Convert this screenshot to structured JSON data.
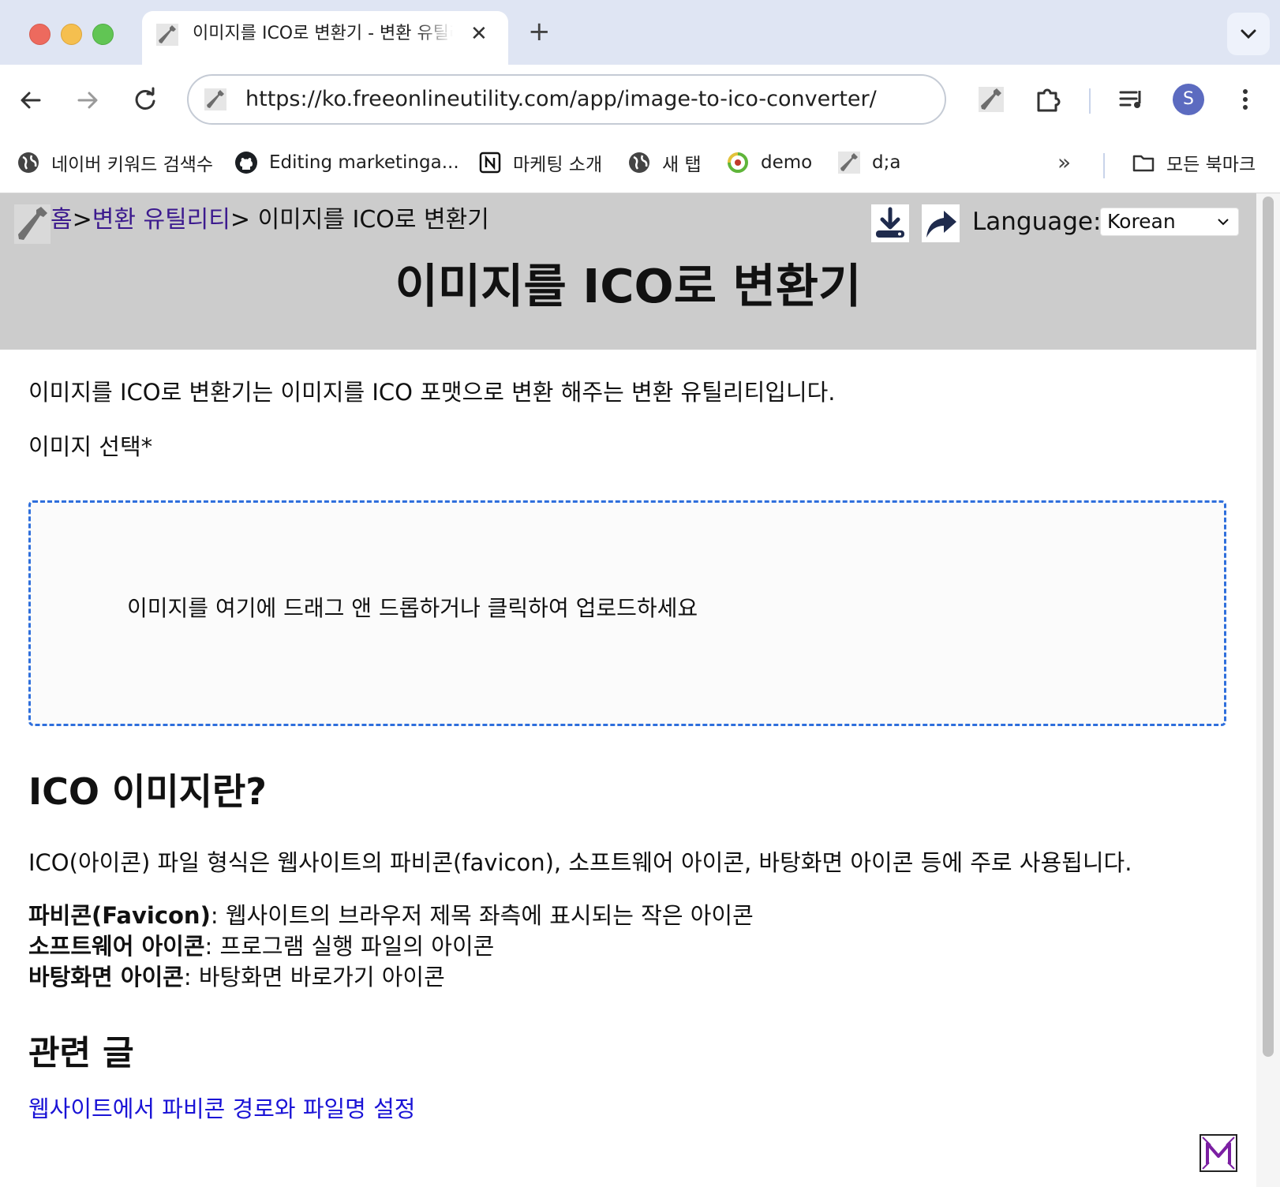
{
  "browser": {
    "tab": {
      "title": "이미지를 ICO로 변환기 - 변환 유틸리티"
    },
    "address_bar": {
      "url": "https://ko.freeonlineutility.com/app/image-to-ico-converter/"
    },
    "profile_initial": "S",
    "bookmarks": [
      {
        "label": "네이버 키워드 검색수",
        "icon": "globe-icon"
      },
      {
        "label": "Editing marketinga...",
        "icon": "github-icon"
      },
      {
        "label": "마케팅 소개",
        "icon": "notion-icon"
      },
      {
        "label": "새 탭",
        "icon": "globe-icon"
      },
      {
        "label": "demo",
        "icon": "recycle-icon"
      },
      {
        "label": "d;a",
        "icon": "wrench-icon"
      }
    ],
    "all_bookmarks_label": "모든 북마크"
  },
  "page": {
    "breadcrumb": {
      "home": "홈",
      "sep1": ">",
      "category": "변환 유틸리티",
      "current": "> 이미지를 ICO로 변환기"
    },
    "language_label": "Language:",
    "language_value": "Korean",
    "title": "이미지를 ICO로 변환기",
    "intro": "이미지를 ICO로 변환기는 이미지를 ICO 포맷으로 변환 해주는 변환 유틸리티입니다.",
    "select_label": "이미지 선택*",
    "dropzone_text": "이미지를 여기에 드래그 앤 드롭하거나 클릭하여 업로드하세요",
    "what_heading": "ICO 이미지란?",
    "description": "ICO(아이콘) 파일 형식은 웹사이트의 파비콘(favicon), 소프트웨어 아이콘, 바탕화면 아이콘 등에 주로 사용됩니다.",
    "uses": [
      {
        "term": "파비콘(Favicon)",
        "text": ": 웹사이트의 브라우저 제목 좌측에 표시되는 작은 아이콘"
      },
      {
        "term": "소프트웨어 아이콘",
        "text": ": 프로그램 실행 파일의 아이콘"
      },
      {
        "term": "바탕화면 아이콘",
        "text": ": 바탕화면 바로가기 아이콘"
      }
    ],
    "related_heading": "관련 글",
    "related_link": "웹사이트에서 파비콘 경로와 파일명 설정"
  },
  "colors": {
    "tab_strip": "#dfe5f3",
    "page_header": "#cccccc",
    "dropzone_border": "#2f6fdc",
    "link": "#1a13d6",
    "visited_link": "#3c1a8e",
    "avatar": "#5c6bc0"
  }
}
